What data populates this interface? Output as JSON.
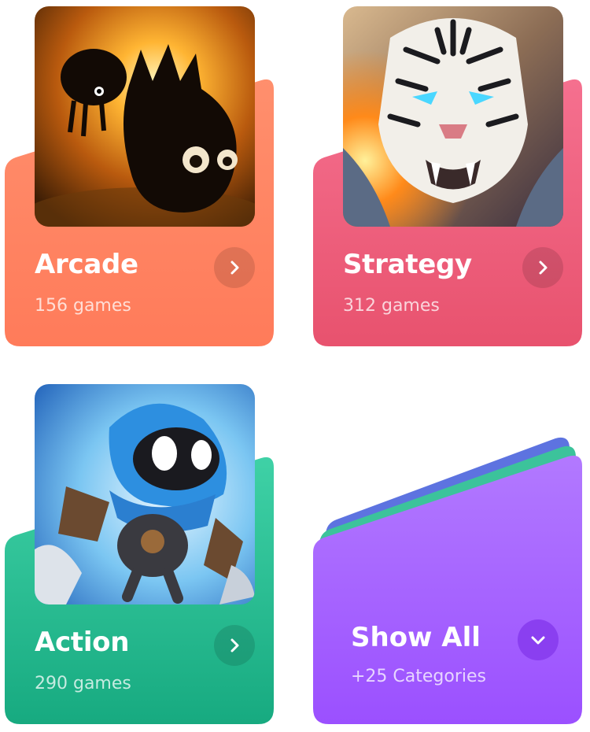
{
  "colors": {
    "arcade": [
      "#ff8f6d",
      "#ff7b5a"
    ],
    "strategy": [
      "#f5708f",
      "#e8526e"
    ],
    "action": [
      "#3fd1a6",
      "#17aa80"
    ],
    "showall": [
      "#b279ff",
      "#9b50ff"
    ],
    "stack_blue": "#5d73e0",
    "stack_green": "#3cc39b"
  },
  "categories": [
    {
      "title": "Arcade",
      "count": "156 games",
      "thumbnail": "badland-creatures-illustration",
      "icon": "chevron-right-icon"
    },
    {
      "title": "Strategy",
      "count": "312 games",
      "thumbnail": "white-tiger-illustration",
      "icon": "chevron-right-icon"
    },
    {
      "title": "Action",
      "count": "290 games",
      "thumbnail": "ninja-robot-illustration",
      "icon": "chevron-right-icon"
    }
  ],
  "show_all": {
    "title": "Show All",
    "subtitle": "+25 Categories",
    "icon": "chevron-down-icon"
  }
}
